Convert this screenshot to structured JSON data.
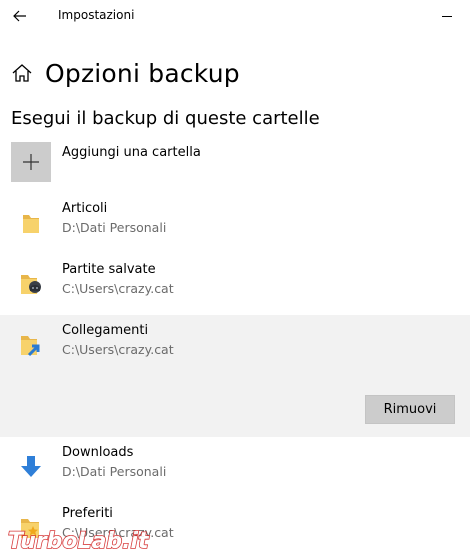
{
  "titlebar": {
    "app_title": "Impostazioni"
  },
  "header": {
    "title": "Opzioni backup"
  },
  "section": {
    "title": "Esegui il backup di queste cartelle"
  },
  "add_folder": {
    "label": "Aggiungi una cartella"
  },
  "folders": [
    {
      "name": "Articoli",
      "path": "D:\\Dati Personali",
      "icon": "folder-icon"
    },
    {
      "name": "Partite salvate",
      "path": "C:\\Users\\crazy.cat",
      "icon": "saved-games-folder-icon"
    },
    {
      "name": "Collegamenti",
      "path": "C:\\Users\\crazy.cat",
      "icon": "links-folder-icon",
      "selected": true
    },
    {
      "name": "Downloads",
      "path": "D:\\Dati Personali",
      "icon": "download-arrow-icon"
    },
    {
      "name": "Preferiti",
      "path": "C:\\Users\\crazy.cat",
      "icon": "favorites-folder-icon"
    }
  ],
  "remove_button": {
    "label": "Rimuovi"
  },
  "watermark": {
    "text": "TurboLab.it"
  }
}
